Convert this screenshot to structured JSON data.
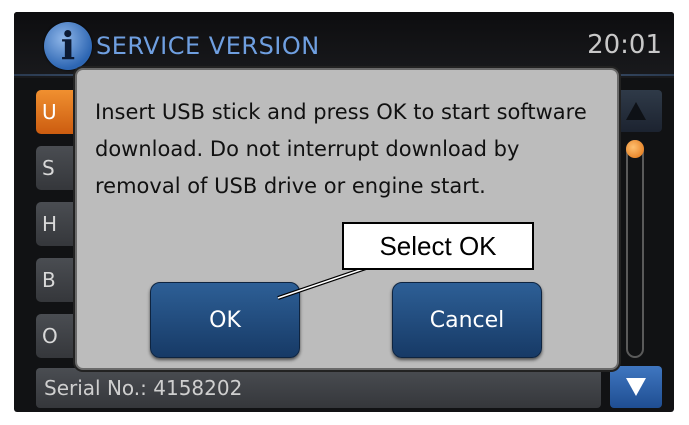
{
  "header": {
    "title": "SERVICE VERSION",
    "clock": "20:01",
    "icon": "info-icon"
  },
  "list": {
    "items": [
      {
        "label": "U",
        "active": true
      },
      {
        "label": "S",
        "active": false
      },
      {
        "label": "H",
        "active": false
      },
      {
        "label": "B",
        "active": false
      },
      {
        "label": "O",
        "active": false
      }
    ],
    "serial": "Serial No.: 4158202"
  },
  "dialog": {
    "message": "Insert USB stick and press OK to start software download. Do not interrupt download by removal of USB drive or engine start.",
    "ok_label": "OK",
    "cancel_label": "Cancel"
  },
  "annotation": {
    "callout": "Select OK"
  },
  "colors": {
    "accent_orange": "#e07010",
    "title_blue": "#6f9fe0",
    "button_blue": "#2d5f96",
    "dialog_gray": "#bcbcbc"
  }
}
